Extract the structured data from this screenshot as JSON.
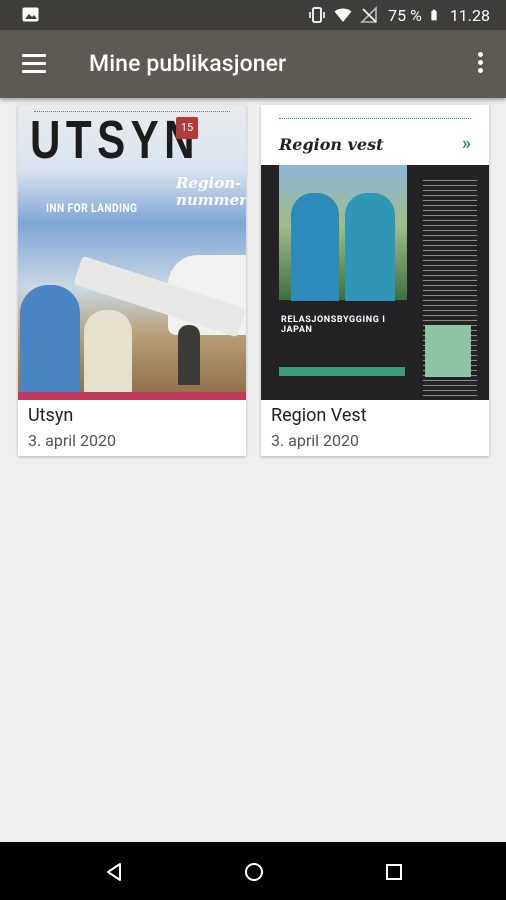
{
  "status_bar": {
    "battery_percent": "75 %",
    "time": "11.28",
    "icons": [
      "gallery-icon",
      "vibrate-icon",
      "wifi-icon",
      "no-signal-icon",
      "battery-icon"
    ]
  },
  "app_bar": {
    "title": "Mine publikasjoner",
    "icons": [
      "menu-icon",
      "more-vert-icon"
    ]
  },
  "publications": [
    {
      "title": "Utsyn",
      "date": "3. april 2020",
      "cover": {
        "masthead": "UTSYN",
        "issue": "15",
        "headline": "Region-\nnummer",
        "subheadline": "INN FOR LANDING"
      }
    },
    {
      "title": "Region Vest",
      "date": "3. april 2020",
      "cover": {
        "masthead": "Region vest",
        "banner": "RELASJONSBYGGING I JAPAN",
        "chevron": "»"
      }
    }
  ],
  "nav_bar": {
    "icons": [
      "back-icon",
      "home-icon",
      "recents-icon"
    ]
  },
  "colors": {
    "status_bar": "#3f3d3a",
    "app_bar": "#5d5953",
    "background": "#efefef",
    "card": "#ffffff",
    "nav_bar": "#000000"
  }
}
